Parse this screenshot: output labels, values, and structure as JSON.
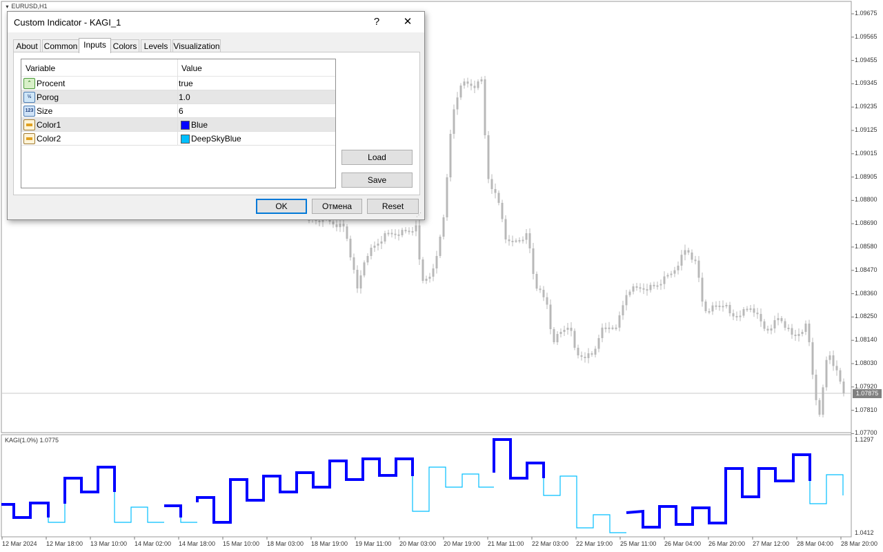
{
  "chart": {
    "symbol_title": "EURUSD,H1",
    "price_labels": [
      "1.09675",
      "1.09565",
      "1.09455",
      "1.09345",
      "1.09235",
      "1.09125",
      "1.09015",
      "1.08905",
      "1.08800",
      "1.08690",
      "1.08580",
      "1.08470",
      "1.08360",
      "1.08250",
      "1.08140",
      "1.08030",
      "1.07920",
      "1.07810",
      "1.07700"
    ],
    "current_price": "1.07875",
    "indicator_title": "KAGI(1.0%) 1.0775",
    "indicator_scale_top": "1.1297",
    "indicator_scale_bottom": "1.0412",
    "time_labels": [
      "12 Mar 2024",
      "12 Mar 18:00",
      "13 Mar 10:00",
      "14 Mar 02:00",
      "14 Mar 18:00",
      "15 Mar 10:00",
      "18 Mar 03:00",
      "18 Mar 19:00",
      "19 Mar 11:00",
      "20 Mar 03:00",
      "20 Mar 19:00",
      "21 Mar 11:00",
      "22 Mar 03:00",
      "22 Mar 19:00",
      "25 Mar 11:00",
      "26 Mar 04:00",
      "26 Mar 20:00",
      "27 Mar 12:00",
      "28 Mar 04:00",
      "28 Mar 20:00"
    ],
    "candle_color": "#808080",
    "kagi_color_1": "#0000ff",
    "kagi_color_2": "#00bfff"
  },
  "dialog": {
    "title": "Custom Indicator - KAGI_1",
    "help_label": "?",
    "close_label": "✕",
    "tabs": [
      "About",
      "Common",
      "Inputs",
      "Colors",
      "Levels",
      "Visualization"
    ],
    "active_tab": "Inputs",
    "columns": [
      "Variable",
      "Value"
    ],
    "rows": [
      {
        "name": "Procent",
        "value": "true",
        "icon": "boolean-icon"
      },
      {
        "name": "Porog",
        "value": "1.0",
        "icon": "double-icon"
      },
      {
        "name": "Size",
        "value": "6",
        "icon": "integer-icon"
      },
      {
        "name": "Color1",
        "value": "Blue",
        "icon": "color-icon",
        "swatch": "#0000ff"
      },
      {
        "name": "Color2",
        "value": "DeepSkyBlue",
        "icon": "color-icon",
        "swatch": "#00bfff"
      }
    ],
    "load_label": "Load",
    "save_label": "Save",
    "ok_label": "OK",
    "cancel_label": "Отмена",
    "reset_label": "Reset"
  }
}
